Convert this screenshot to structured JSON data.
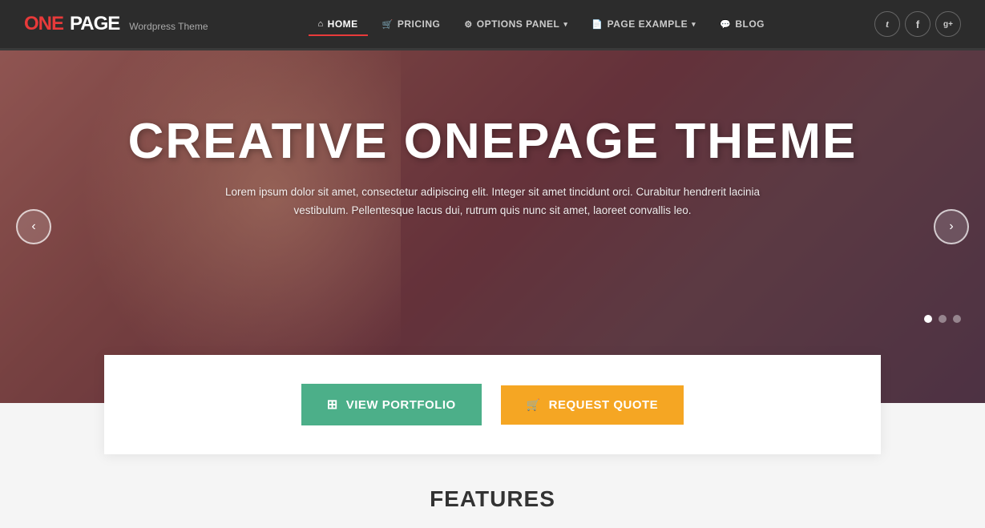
{
  "brand": {
    "one": "ONE",
    "page": "PAGE",
    "sub": "Wordpress Theme"
  },
  "nav": {
    "items": [
      {
        "id": "home",
        "label": "HOME",
        "icon": "⌂",
        "active": true
      },
      {
        "id": "pricing",
        "label": "PRICING",
        "icon": "🛒"
      },
      {
        "id": "options",
        "label": "OPTIONS PANEL",
        "icon": "⚙",
        "dropdown": true
      },
      {
        "id": "page-example",
        "label": "PAGE EXAMPLE",
        "icon": "📄",
        "dropdown": true
      },
      {
        "id": "blog",
        "label": "BLOG",
        "icon": "💬"
      }
    ],
    "social": [
      {
        "id": "twitter",
        "icon": "t"
      },
      {
        "id": "facebook",
        "icon": "f"
      },
      {
        "id": "google-plus",
        "icon": "g+"
      }
    ]
  },
  "hero": {
    "title": "CREATIVE ONEPAGE THEME",
    "subtitle": "Lorem ipsum dolor sit amet, consectetur adipiscing elit. Integer sit amet tincidunt orci. Curabitur hendrerit lacinia vestibulum. Pellentesque lacus dui, rutrum quis nunc sit amet, laoreet convallis leo.",
    "slider": {
      "prev_label": "‹",
      "next_label": "›",
      "dots": [
        {
          "active": true
        },
        {
          "active": false
        },
        {
          "active": false
        }
      ]
    }
  },
  "cta": {
    "portfolio_label": "View Portfolio",
    "portfolio_icon": "⊞",
    "quote_label": "Request Quote",
    "quote_icon": "🛒"
  },
  "features": {
    "title": "FEATURES"
  }
}
